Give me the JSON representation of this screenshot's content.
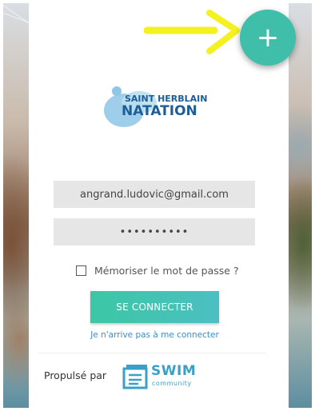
{
  "brand": {
    "logo_line1": "SAINT HERBLAIN",
    "logo_line2": "NATATION"
  },
  "fab": {
    "label": "+",
    "color": "#3fbfa9"
  },
  "annotation": {
    "arrow_color": "#f5f020"
  },
  "login": {
    "email_value": "angrand.ludovic@gmail.com",
    "password_value": "••••••••••",
    "remember_label": "Mémoriser le mot de passe ?",
    "remember_checked": false,
    "submit_label": "SE CONNECTER",
    "forgot_label": "Je n'arrive pas à me connecter"
  },
  "footer": {
    "powered_label": "Propulsé par",
    "swim_word": "SWIM",
    "swim_sub": "community"
  },
  "colors": {
    "accent": "#3cc7a5",
    "link": "#3a8ec1",
    "logo_blue": "#2a73b0"
  }
}
